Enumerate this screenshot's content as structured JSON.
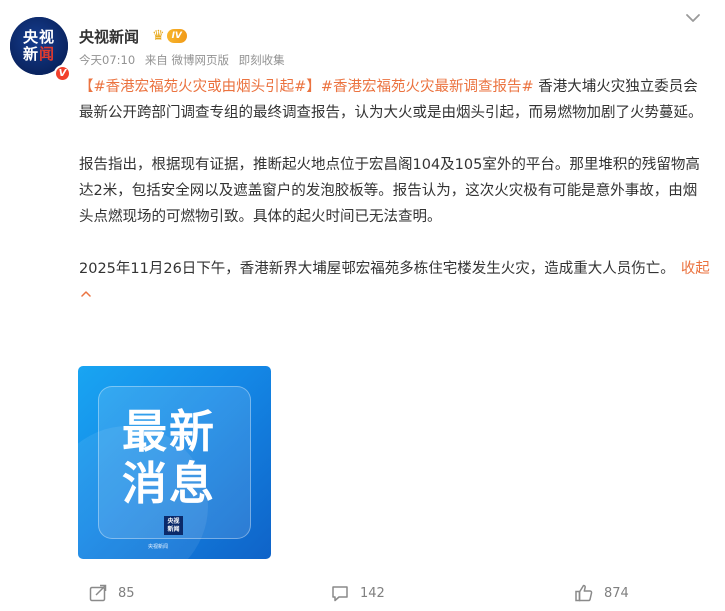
{
  "header": {
    "avatar": {
      "line1": "央视",
      "line2_a": "新",
      "line2_b": "闻",
      "verified": "V"
    },
    "username": "央视新闻",
    "badge": {
      "level": "IV"
    },
    "meta": {
      "time": "今天07:10",
      "source": "来自 微博网页版",
      "edit": "即刻收集"
    }
  },
  "post": {
    "p1_topic1": "【#香港宏福苑火灾或由烟头引起#】",
    "p1_topic2": "#香港宏福苑火灾最新调查报告#",
    "p1_body": " 香港大埔火灾独立委员会最新公开跨部门调查专组的最终调查报告，认为大火或是由烟头引起，而易燃物加剧了火势蔓延。",
    "p2": "报告指出，根据现有证据，推断起火地点位于宏昌阁104及105室外的平台。那里堆积的残留物高达2米，包括安全网以及遮盖窗户的发泡胶板等。报告认为，这次火灾极有可能是意外事故，由烟头点燃现场的可燃物引致。具体的起火时间已无法查明。",
    "p3": "2025年11月26日下午，香港新界大埔屋邨宏福苑多栋住宅楼发生火灾，造成重大人员伤亡。",
    "collapse": "收起"
  },
  "image": {
    "line1": "最新",
    "line2": "消息",
    "logo_a": "央视",
    "logo_b": "新闻",
    "footer": "央视新闻"
  },
  "actions": {
    "repost_count": "85",
    "comment_count": "142",
    "like_count": "874"
  },
  "colors": {
    "topic": "#eb7340",
    "meta": "#939393",
    "avatar_bg": "#0a2a6a",
    "image_bg": "#1488e6"
  }
}
